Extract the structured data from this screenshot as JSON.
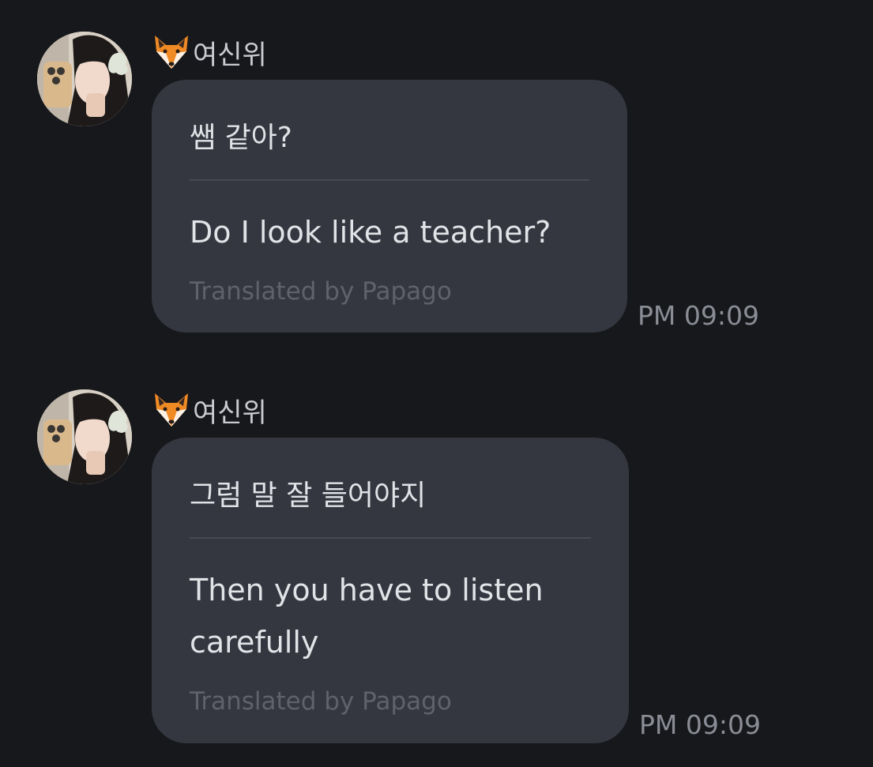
{
  "colors": {
    "background": "#17181c",
    "bubble": "#343740",
    "text_primary": "#e2e3e7",
    "text_secondary": "#8a8d95",
    "credit": "#5f626b",
    "divider": "#474a53"
  },
  "messages": [
    {
      "sender_icon": "fox-emoji-icon",
      "sender_name": "여신위",
      "original": "쌤 같아?",
      "translated": "Do I look like a teacher?",
      "credit": "Translated by Papago",
      "time": "PM 09:09"
    },
    {
      "sender_icon": "fox-emoji-icon",
      "sender_name": "여신위",
      "original": "그럼 말 잘 들어야지",
      "translated": "Then you have to listen carefully",
      "credit": "Translated by Papago",
      "time": "PM 09:09"
    }
  ]
}
